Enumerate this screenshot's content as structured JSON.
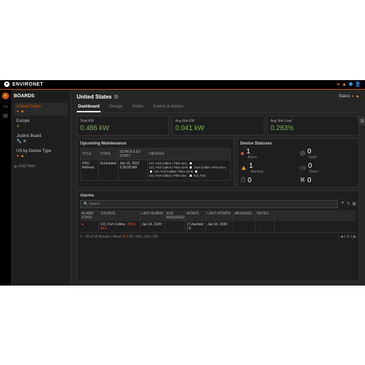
{
  "brand": "ENVIRONET",
  "page_title": "United States",
  "status_label": "Status",
  "sidebar": {
    "title": "BOARDS",
    "add_label": "Add New",
    "items": [
      {
        "name": "United States",
        "active": true,
        "icons": [
          "alarm",
          "warn"
        ]
      },
      {
        "name": "Europe",
        "icons": [
          "ok"
        ]
      },
      {
        "name": "Justins Board",
        "icons": [
          "wrench",
          "cross"
        ]
      },
      {
        "name": "US by Device Type",
        "icons": [
          "alarm",
          "warn"
        ]
      }
    ]
  },
  "tabs": [
    "Dashboard",
    "Groups",
    "Points",
    "Events & Alarms"
  ],
  "kpis": [
    {
      "label": "Total KW",
      "value": "0.486 kW"
    },
    {
      "label": "Avg Site KW",
      "value": "0.041 kW"
    },
    {
      "label": "Avg Site Load",
      "value": "0.283%"
    }
  ],
  "maintenance": {
    "title": "Upcoming Maintenance",
    "headers": [
      "TITLE",
      "STATE",
      "SCHEDULED START",
      "DEVICES"
    ],
    "row": {
      "title": "PDU Refresh",
      "state": "Scheduled",
      "start": "Jan 16, 2022 2:00:00 AM",
      "devices": [
        "CO, Fort Collins / PDU-42-L",
        "CO, Fort Collins / PDU-42-R",
        "Fort Collins / PDU-43-L",
        "CO, Fort Collins / PDU-43-R",
        "CO, Fort Collins / PDU-44-L",
        "CO, Fort"
      ]
    }
  },
  "device_statuses": {
    "title": "Device Statuses",
    "items": [
      {
        "icon": "alarm",
        "num": "1",
        "label": "Alarm"
      },
      {
        "icon": "fault",
        "num": "0",
        "label": "Fault"
      },
      {
        "icon": "warn",
        "num": "1",
        "label": "Warning"
      },
      {
        "icon": "down",
        "num": "0",
        "label": "Down"
      },
      {
        "icon": "maint",
        "num": "0",
        "label": ""
      },
      {
        "icon": "wrench",
        "num": "0",
        "label": ""
      }
    ]
  },
  "alarms": {
    "title": "Alarms",
    "search_placeholder": "Search",
    "headers": [
      "ALARM STATE",
      "SOURCE",
      "LAST ALARM",
      "ACK REQUIRED",
      "ACKED",
      "LAST UPDATE",
      "MESSAGE",
      "NOTES"
    ],
    "row": {
      "state": "",
      "source": "CO, Fort Collins / PDU-43-L",
      "last_alarm": "Jan 16, 2020",
      "ack_required": "",
      "acked": "2 Unacked / 0",
      "last_update": "Jan 16, 2020",
      "message": "",
      "notes": ""
    },
    "pager_left": "1 - 18 of 18 Results | Show",
    "pager_sizes": [
      "25",
      "50",
      "100",
      "150",
      "200"
    ],
    "pager_right": "1 of 1"
  }
}
